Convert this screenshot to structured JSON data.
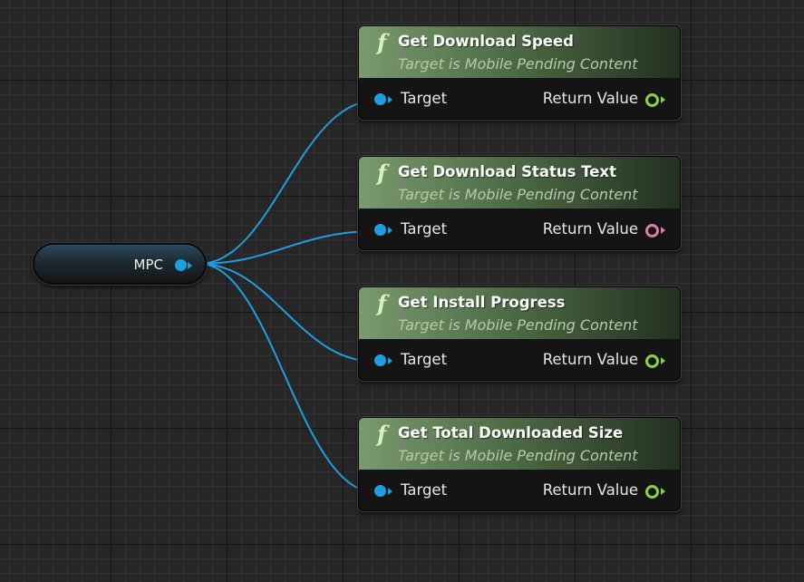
{
  "variable_node": {
    "label": "MPC",
    "pin_color": "#1d9ee2"
  },
  "function_nodes": [
    {
      "icon": "f",
      "title": "Get Download Speed",
      "subtitle": "Target is Mobile Pending Content",
      "input_label": "Target",
      "output_label": "Return Value",
      "output_pin_color": "#8bd33a"
    },
    {
      "icon": "f",
      "title": "Get Download Status Text",
      "subtitle": "Target is Mobile Pending Content",
      "input_label": "Target",
      "output_label": "Return Value",
      "output_pin_color": "#d97caa"
    },
    {
      "icon": "f",
      "title": "Get Install Progress",
      "subtitle": "Target is Mobile Pending Content",
      "input_label": "Target",
      "output_label": "Return Value",
      "output_pin_color": "#8bd33a"
    },
    {
      "icon": "f",
      "title": "Get Total Downloaded Size",
      "subtitle": "Target is Mobile Pending Content",
      "input_label": "Target",
      "output_label": "Return Value",
      "output_pin_color": "#8bd33a"
    }
  ],
  "wire_color": "#1d9ee2"
}
